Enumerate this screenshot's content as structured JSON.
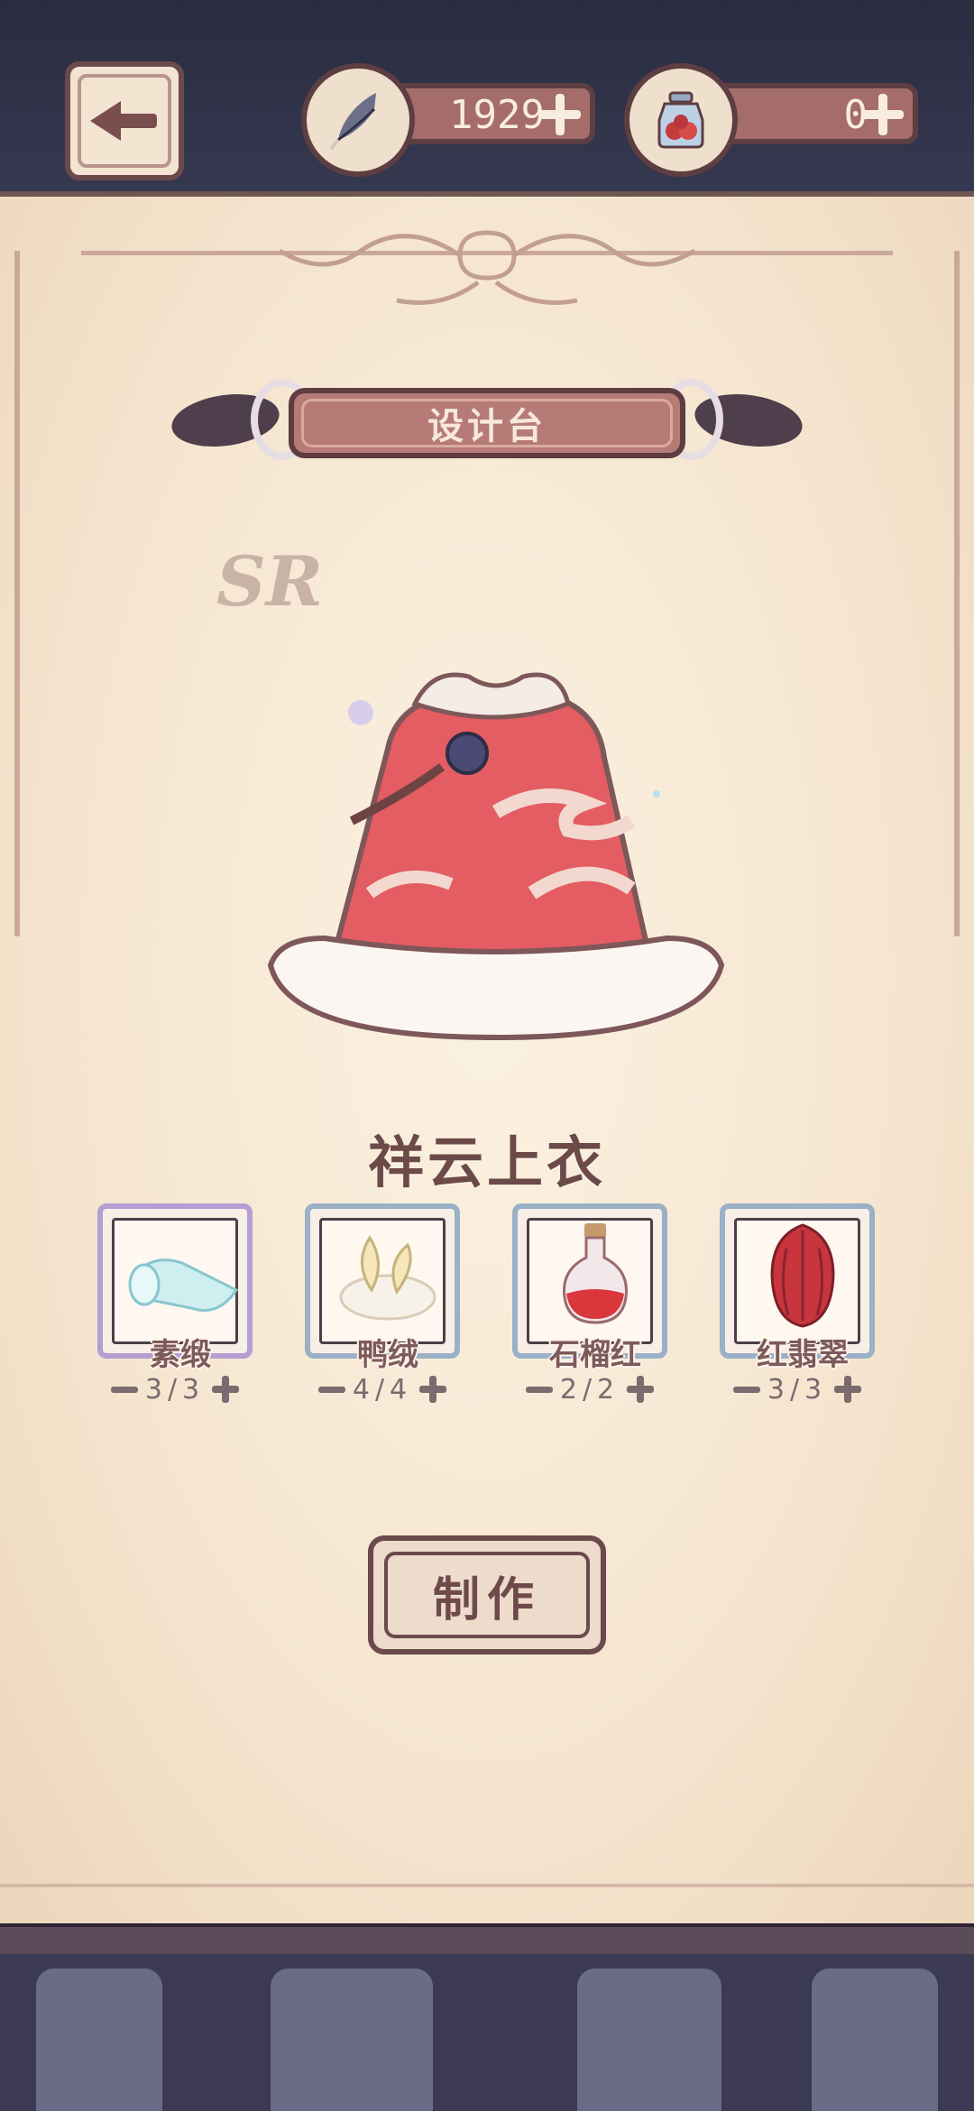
{
  "currencies": {
    "feather": {
      "value": "1929",
      "icon": "feather-icon"
    },
    "potion": {
      "value": "0",
      "icon": "berry-jar-icon"
    }
  },
  "screen": {
    "title": "设计台",
    "rarity": "SR",
    "item_name": "祥云上衣",
    "make_label": "制作"
  },
  "materials": [
    {
      "name": "素缎",
      "current": 3,
      "required": 3,
      "count_text": "3/3",
      "icon": "silk-roll-icon"
    },
    {
      "name": "鸭绒",
      "current": 4,
      "required": 4,
      "count_text": "4/4",
      "icon": "down-feather-icon"
    },
    {
      "name": "石榴红",
      "current": 2,
      "required": 2,
      "count_text": "2/2",
      "icon": "red-potion-icon"
    },
    {
      "name": "红翡翠",
      "current": 3,
      "required": 3,
      "count_text": "3/3",
      "icon": "red-jade-icon"
    }
  ],
  "colors": {
    "accent": "#b67a77",
    "frame_dark": "#5e3c40",
    "paper": "#f7e9d6"
  }
}
